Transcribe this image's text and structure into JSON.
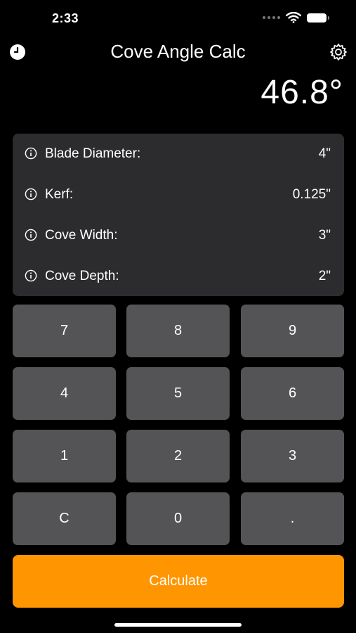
{
  "status_bar": {
    "time": "2:33"
  },
  "header": {
    "title": "Cove Angle Calc"
  },
  "result": {
    "value": "46.8°"
  },
  "inputs": [
    {
      "label": "Blade Diameter:",
      "value": "4\""
    },
    {
      "label": "Kerf:",
      "value": "0.125\""
    },
    {
      "label": "Cove Width:",
      "value": "3\""
    },
    {
      "label": "Cove Depth:",
      "value": "2\""
    }
  ],
  "keypad": {
    "k7": "7",
    "k8": "8",
    "k9": "9",
    "k4": "4",
    "k5": "5",
    "k6": "6",
    "k1": "1",
    "k2": "2",
    "k3": "3",
    "clear": "C",
    "k0": "0",
    "dot": "."
  },
  "calculate_label": "Calculate",
  "colors": {
    "accent": "#ff9500",
    "panel": "#2c2c2e",
    "key": "#545456",
    "background": "#000000"
  },
  "icons": {
    "history": "clock-icon",
    "settings": "gear-icon",
    "info": "info-icon"
  }
}
